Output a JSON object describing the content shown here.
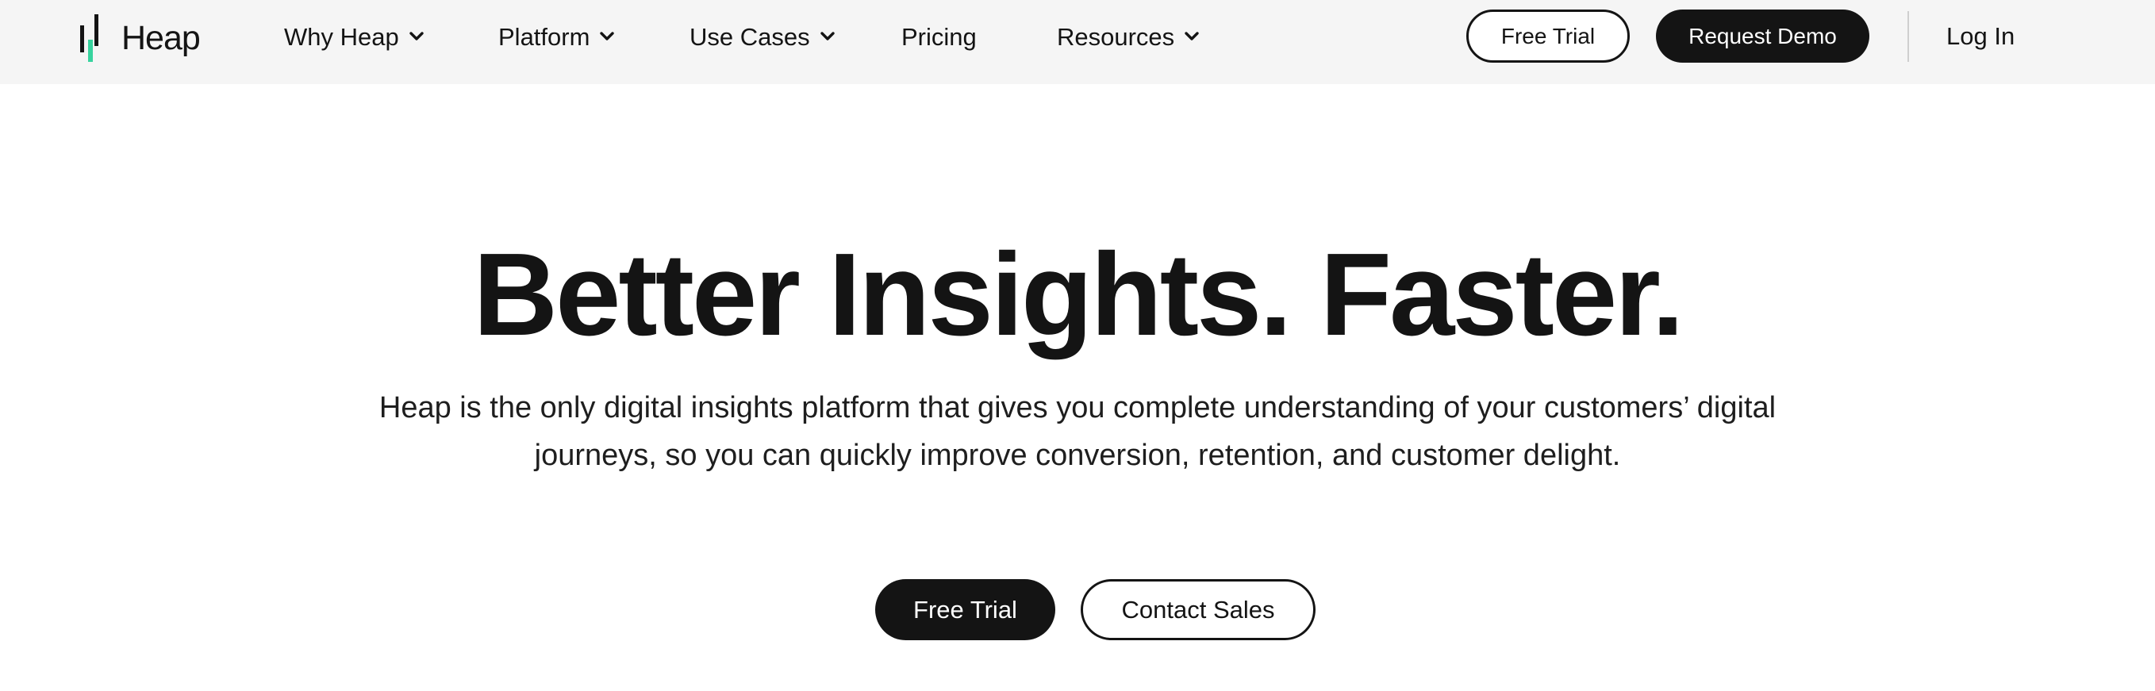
{
  "brand": {
    "name": "Heap",
    "accent_color": "#37d39e",
    "dark_color": "#141414"
  },
  "nav": {
    "items": [
      {
        "label": "Why Heap",
        "has_dropdown": true,
        "icon": "chevron-down-icon"
      },
      {
        "label": "Platform",
        "has_dropdown": true,
        "icon": "chevron-down-icon"
      },
      {
        "label": "Use Cases",
        "has_dropdown": true,
        "icon": "chevron-down-icon"
      },
      {
        "label": "Pricing",
        "has_dropdown": false
      },
      {
        "label": "Resources",
        "has_dropdown": true,
        "icon": "chevron-down-icon"
      }
    ],
    "free_trial_label": "Free Trial",
    "request_demo_label": "Request Demo",
    "login_label": "Log In"
  },
  "hero": {
    "title": "Better Insights. Faster.",
    "subtitle": "Heap is the only digital insights platform that gives you complete understanding of your customers’ digital journeys, so you can quickly improve conversion, retention, and customer delight.",
    "primary_cta": "Free Trial",
    "secondary_cta": "Contact Sales"
  },
  "colors": {
    "header_bg": "#f5f5f5",
    "page_bg": "#ffffff",
    "text": "#141414"
  }
}
